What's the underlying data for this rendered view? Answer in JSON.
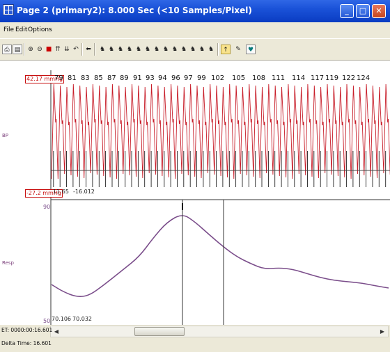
{
  "window": {
    "title": "Page 2 (primary2): 8.000 Sec    (<10 Samples/Pixel)"
  },
  "menu": [
    "File",
    "Edit",
    "Options"
  ],
  "toolbar": {
    "icons": [
      "print-icon",
      "preview-icon",
      "zoom-in-icon",
      "zoom-out-icon",
      "marker-icon",
      "scroll-up-icon",
      "scroll-down-icon",
      "undo-icon",
      "back-icon",
      "marker-q-icon",
      "marker-v-icon",
      "marker-s-icon",
      "marker-t-icon",
      "marker-r-icon",
      "marker-u-icon",
      "marker-w-icon",
      "marker-x-icon",
      "marker-y-icon",
      "marker-z-icon",
      "marker-a-icon",
      "flag-icon",
      "edit-icon",
      "ecg-icon"
    ]
  },
  "channels": {
    "bp": {
      "label": "BP",
      "top_value": "42.17 mmHg",
      "bottom_value": "-27.2 mmHg",
      "left_readout": "11.65",
      "right_readout": "-16.012",
      "color": "#c81e2a",
      "beat_labels": [
        "79",
        "81",
        "83",
        "85",
        "87",
        "89",
        "91",
        "93",
        "94",
        "96",
        "97",
        "99",
        "102",
        "105",
        "108",
        "111",
        "114",
        "117",
        "119",
        "122",
        "124"
      ]
    },
    "resp": {
      "label": "Resp",
      "top_value": "90",
      "bottom_value": "50",
      "left_readout": "70.106",
      "right_readout": "70.032",
      "color": "#7b4e8b"
    }
  },
  "status": {
    "elapsed": "ET: 0000:00:16.601",
    "delta": "Delta Time: 16.601"
  }
}
